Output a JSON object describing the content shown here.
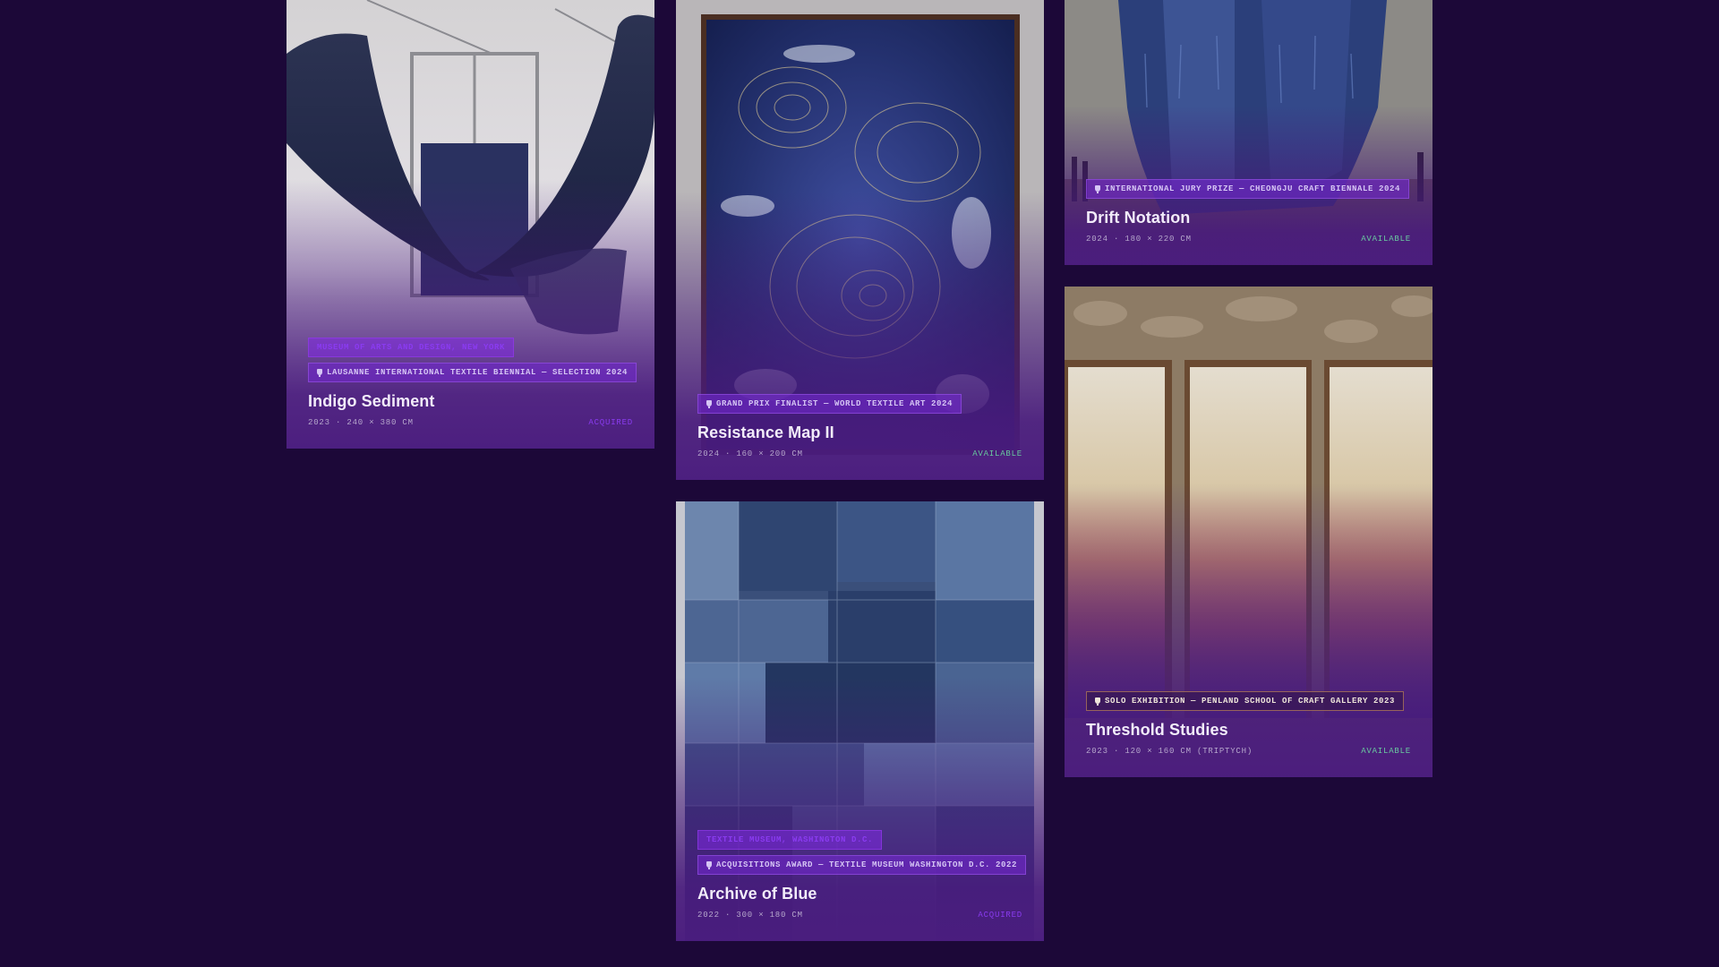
{
  "colors": {
    "background": "#1c0838",
    "card_shade": "#4a1c7e",
    "badge_venue_text": "#8a3bf0",
    "status_available": "#69c9a0",
    "status_acquired": "#8a3bf0"
  },
  "works": [
    {
      "venue": "MUSEUM OF ARTS AND DESIGN, NEW YORK",
      "award": "LAUSANNE INTERNATIONAL TEXTILE BIENNIAL — SELECTION 2024",
      "title": "Indigo Sediment",
      "meta": "2023 · 240 × 380 CM",
      "status": "ACQUIRED",
      "image_icon": "hanging-indigo-fabric-installation"
    },
    {
      "award": "GRAND PRIX FINALIST — WORLD TEXTILE ART 2024",
      "title": "Resistance Map II",
      "meta": "2024 · 160 × 200 CM",
      "status": "AVAILABLE",
      "image_icon": "framed-shibori-contour-map"
    },
    {
      "award": "INTERNATIONAL JURY PRIZE — CHEONGJU CRAFT BIENNALE 2024",
      "title": "Drift Notation",
      "meta": "2024 · 180 × 220 CM",
      "status": "AVAILABLE",
      "image_icon": "sculptural-woven-columns"
    },
    {
      "award": "SOLO EXHIBITION — PENLAND SCHOOL OF CRAFT GALLERY 2023",
      "title": "Threshold Studies",
      "meta": "2023 · 120 × 160 CM (TRIPTYCH)",
      "status": "AVAILABLE",
      "image_icon": "gradient-dyed-triptych"
    },
    {
      "venue": "TEXTILE MUSEUM, WASHINGTON D.C.",
      "award": "ACQUISITIONS AWARD — TEXTILE MUSEUM WASHINGTON D.C. 2022",
      "title": "Archive of Blue",
      "meta": "2022 · 300 × 180 CM",
      "status": "ACQUIRED",
      "image_icon": "patchwork-indigo-quilt"
    }
  ]
}
